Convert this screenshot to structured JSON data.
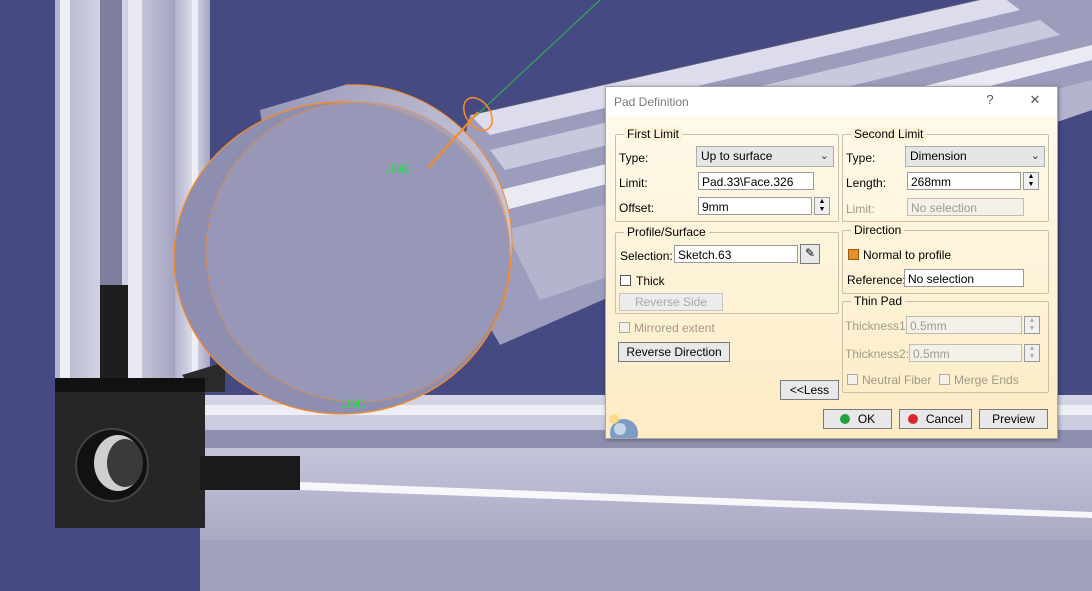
{
  "scene": {
    "bg_color": "#464a82",
    "labels": {
      "lim2": "LIM2",
      "lim1": "LIM1"
    }
  },
  "dialog": {
    "title": "Pad Definition",
    "help_symbol": "?",
    "close_symbol": "✕",
    "first_limit": {
      "legend": "First Limit",
      "type_label": "Type:",
      "type_value": "Up to surface",
      "limit_label": "Limit:",
      "limit_value": "Pad.33\\Face.326",
      "offset_label": "Offset:",
      "offset_value": "9mm"
    },
    "profile": {
      "legend": "Profile/Surface",
      "selection_label": "Selection:",
      "selection_value": "Sketch.63",
      "thick_label": "Thick",
      "reverse_side_label": "Reverse Side"
    },
    "mirrored_label": "Mirrored extent",
    "reverse_direction_label": "Reverse Direction",
    "less_label": "<<Less",
    "second_limit": {
      "legend": "Second Limit",
      "type_label": "Type:",
      "type_value": "Dimension",
      "length_label": "Length:",
      "length_value": "268mm",
      "limit_label": "Limit:",
      "limit_value": "No selection"
    },
    "direction": {
      "legend": "Direction",
      "normal_label": "Normal to profile",
      "normal_checked": true,
      "reference_label": "Reference:",
      "reference_value": "No selection"
    },
    "thin_pad": {
      "legend": "Thin Pad",
      "thickness1_label": "Thickness1:",
      "thickness1_value": "0.5mm",
      "thickness2_label": "Thickness2:",
      "thickness2_value": "0.5mm",
      "neutral_label": "Neutral Fiber",
      "merge_label": "Merge Ends"
    },
    "ok_label": "OK",
    "cancel_label": "Cancel",
    "preview_label": "Preview",
    "colors": {
      "ok_dot": "#22a43a",
      "cancel_dot": "#d8262a",
      "accent": "#e6902c"
    }
  }
}
